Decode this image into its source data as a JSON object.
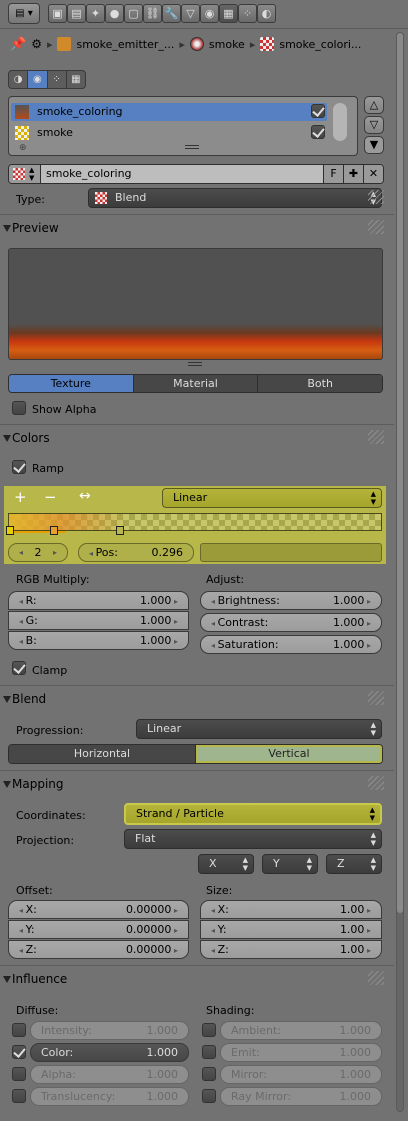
{
  "context": {
    "object": "smoke_emitter_...",
    "material": "smoke",
    "texture": "smoke_colori..."
  },
  "texture_list": {
    "items": [
      "smoke_coloring",
      "smoke"
    ]
  },
  "datablock": {
    "name": "smoke_coloring",
    "fake_user": "F"
  },
  "type": {
    "label": "Type:",
    "value": "Blend"
  },
  "preview": {
    "title": "Preview",
    "tabs": [
      "Texture",
      "Material",
      "Both"
    ],
    "show_alpha": "Show Alpha",
    "gradient": [
      "#515151",
      "#515151",
      "#c7380f",
      "#d65d12",
      "#a8470e"
    ]
  },
  "colors": {
    "title": "Colors",
    "ramp_label": "Ramp",
    "ramp_add": "+",
    "ramp_remove": "−",
    "ramp_flip": "↔",
    "interp": "Linear",
    "active_index": "2",
    "pos_label": "Pos:",
    "pos_value": "0.296",
    "rgb_title": "RGB Multiply:",
    "adjust_title": "Adjust:",
    "rgb": [
      {
        "label": "R:",
        "value": "1.000"
      },
      {
        "label": "G:",
        "value": "1.000"
      },
      {
        "label": "B:",
        "value": "1.000"
      }
    ],
    "adjust": [
      {
        "label": "Brightness:",
        "value": "1.000"
      },
      {
        "label": "Contrast:",
        "value": "1.000"
      },
      {
        "label": "Saturation:",
        "value": "1.000"
      }
    ],
    "clamp": "Clamp"
  },
  "blend": {
    "title": "Blend",
    "progression_label": "Progression:",
    "progression": "Linear",
    "dir_h": "Horizontal",
    "dir_v": "Vertical"
  },
  "mapping": {
    "title": "Mapping",
    "coords_label": "Coordinates:",
    "coords": "Strand / Particle",
    "proj_label": "Projection:",
    "proj": "Flat",
    "axes": [
      "X",
      "Y",
      "Z"
    ],
    "offset_title": "Offset:",
    "size_title": "Size:",
    "offset": [
      {
        "label": "X:",
        "value": "0.00000"
      },
      {
        "label": "Y:",
        "value": "0.00000"
      },
      {
        "label": "Z:",
        "value": "0.00000"
      }
    ],
    "size": [
      {
        "label": "X:",
        "value": "1.00"
      },
      {
        "label": "Y:",
        "value": "1.00"
      },
      {
        "label": "Z:",
        "value": "1.00"
      }
    ]
  },
  "influence": {
    "title": "Influence",
    "diffuse_title": "Diffuse:",
    "shading_title": "Shading:",
    "diffuse": [
      {
        "label": "Intensity:",
        "value": "1.000"
      },
      {
        "label": "Color:",
        "value": "1.000"
      },
      {
        "label": "Alpha:",
        "value": "1.000"
      },
      {
        "label": "Translucency:",
        "value": "1.000"
      }
    ],
    "shading": [
      {
        "label": "Ambient:",
        "value": "1.000"
      },
      {
        "label": "Emit:",
        "value": "1.000"
      },
      {
        "label": "Mirror:",
        "value": "1.000"
      },
      {
        "label": "Ray Mirror:",
        "value": "1.000"
      }
    ]
  },
  "colors_theme": {
    "accent": "#5680c2",
    "highlight": "#b8b84a"
  }
}
